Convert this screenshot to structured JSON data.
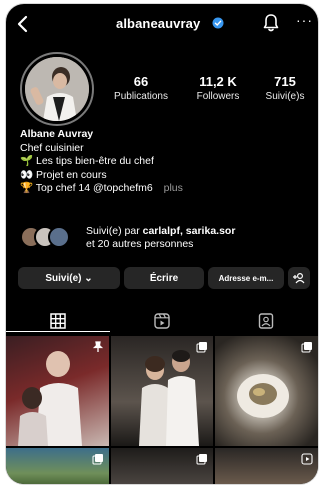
{
  "header": {
    "username": "albaneauvray",
    "icons": [
      "chevron-left-icon",
      "verified-badge-icon",
      "bell-icon",
      "more-icon"
    ],
    "more_label": "···"
  },
  "stats": [
    {
      "value": "66",
      "label": "Publications"
    },
    {
      "value": "11,2 K",
      "label": "Followers"
    },
    {
      "value": "715",
      "label": "Suivi(e)s"
    }
  ],
  "bio": {
    "name": "Albane Auvray",
    "category": "Chef cuisinier",
    "line1": "🌱 Les tips bien-être du chef",
    "line2": "👀 Projet en cours",
    "line3": "🏆 Top chef 14  @topchefm6",
    "more": "plus"
  },
  "followed_by": {
    "prefix": "Suivi(e) par ",
    "names": "carlalpf, sarika.sor",
    "suffix": "et 20 autres personnes"
  },
  "actions": {
    "follow": "Suivi(e) ⌄",
    "message": "Écrire",
    "address": "Adresse e-m...",
    "add_person": "+"
  },
  "tabs": [
    "grid-tab",
    "reels-tab",
    "tagged-tab"
  ],
  "colors": {
    "background": "#000000",
    "button": "#262626",
    "verified": "#3897f0",
    "muted": "#9a9a9a"
  }
}
